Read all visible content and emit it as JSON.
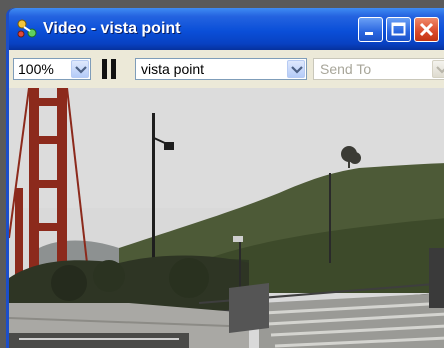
{
  "window": {
    "title": "Video - vista point",
    "title_color": "#ffffff",
    "titlebar_color": "#0a4fd8"
  },
  "toolbar": {
    "zoom": {
      "value": "100%"
    },
    "pause_icon": "pause-icon",
    "source": {
      "value": "vista point"
    },
    "send_to": {
      "value": "Send To",
      "enabled": false
    }
  },
  "video": {
    "description_icon": "video-frame"
  }
}
